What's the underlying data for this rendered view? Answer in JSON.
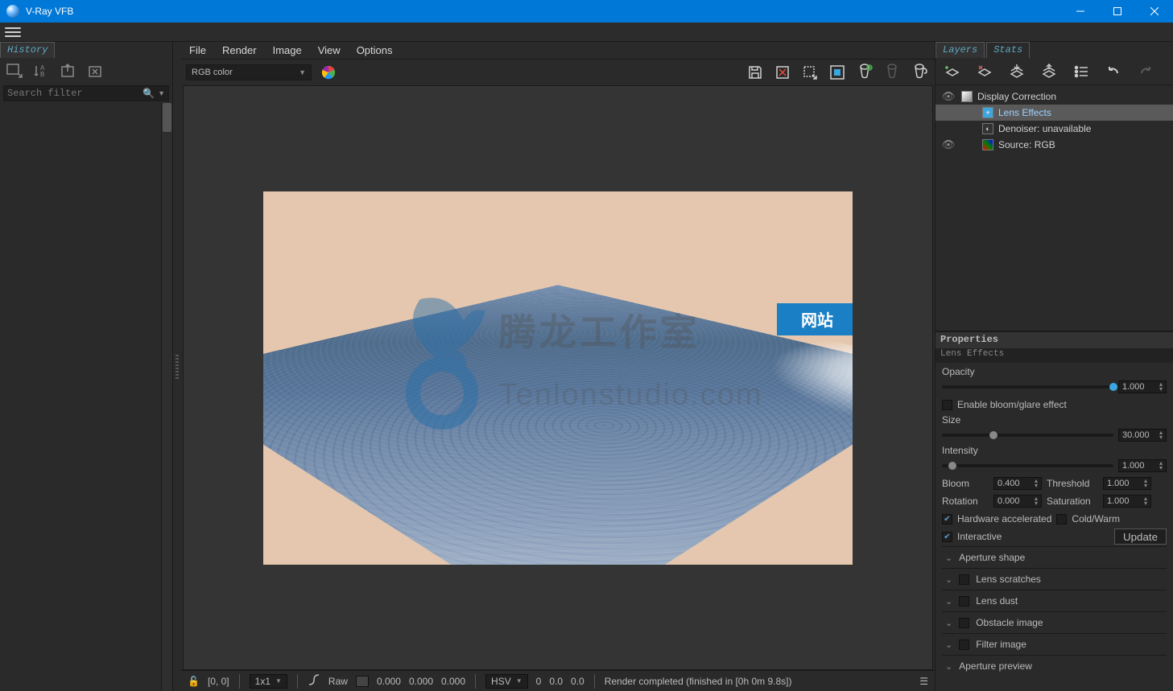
{
  "window": {
    "title": "V-Ray VFB"
  },
  "history": {
    "tab_label": "History",
    "search_placeholder": "Search filter"
  },
  "menu": {
    "file": "File",
    "render": "Render",
    "image": "Image",
    "view": "View",
    "options": "Options"
  },
  "toolbar": {
    "channel_selector": "RGB color"
  },
  "right": {
    "tabs": {
      "layers": "Layers",
      "stats": "Stats"
    },
    "layers": [
      {
        "name": "Display Correction"
      },
      {
        "name": "Lens Effects",
        "selected": true
      },
      {
        "name": "Denoiser: unavailable"
      },
      {
        "name": "Source: RGB"
      }
    ]
  },
  "properties": {
    "header": "Properties",
    "subheader": "Lens Effects",
    "opacity_label": "Opacity",
    "opacity_value": "1.000",
    "enable_bloom_label": "Enable bloom/glare effect",
    "size_label": "Size",
    "size_value": "30.000",
    "intensity_label": "Intensity",
    "intensity_value": "1.000",
    "bloom_label": "Bloom",
    "bloom_value": "0.400",
    "threshold_label": "Threshold",
    "threshold_value": "1.000",
    "rotation_label": "Rotation",
    "rotation_value": "0.000",
    "saturation_label": "Saturation",
    "saturation_value": "1.000",
    "hw_accel_label": "Hardware accelerated",
    "coldwarm_label": "Cold/Warm",
    "interactive_label": "Interactive",
    "update_label": "Update",
    "sections": {
      "aperture_shape": "Aperture shape",
      "lens_scratches": "Lens scratches",
      "lens_dust": "Lens dust",
      "obstacle_image": "Obstacle image",
      "filter_image": "Filter image",
      "aperture_preview": "Aperture preview"
    }
  },
  "statusbar": {
    "coords": "[0, 0]",
    "zoom": "1x1",
    "mode": "Raw",
    "v1": "0.000",
    "v2": "0.000",
    "v3": "0.000",
    "colorspace": "HSV",
    "h": "0",
    "s": "0.0",
    "v": "0.0",
    "message": "Render completed (finished in [0h  0m  9.8s])"
  },
  "watermark": {
    "badge": "网站"
  }
}
